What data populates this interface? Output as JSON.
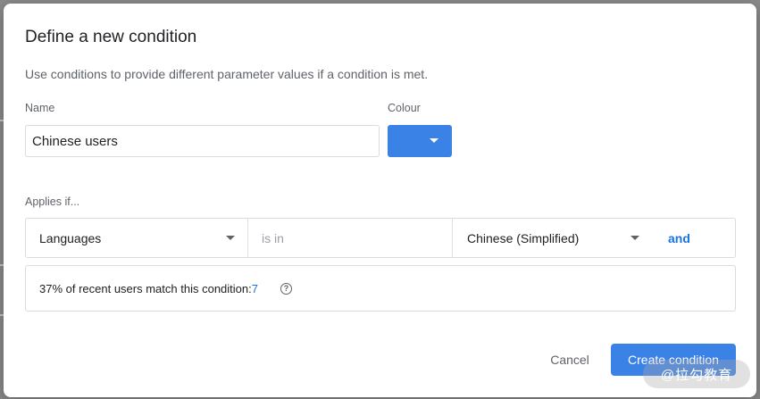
{
  "dialog": {
    "title": "Define a new condition",
    "subtitle": "Use conditions to provide different parameter values if a condition is met."
  },
  "name_field": {
    "label": "Name",
    "value": "Chinese users"
  },
  "colour": {
    "label": "Colour",
    "selected_color": "#3b82e6"
  },
  "rule": {
    "section_label": "Applies if...",
    "property": "Languages",
    "operator_placeholder": "is in",
    "value": "Chinese (Simplified)",
    "and_label": "and"
  },
  "match": {
    "text": "37% of recent users match this condition:",
    "count": "7",
    "help_icon": "?"
  },
  "actions": {
    "cancel_label": "Cancel",
    "create_label": "Create condition"
  },
  "watermark": {
    "text": "@拉勾教育"
  },
  "colors": {
    "accent": "#3b82e6",
    "link": "#1a73e8"
  }
}
